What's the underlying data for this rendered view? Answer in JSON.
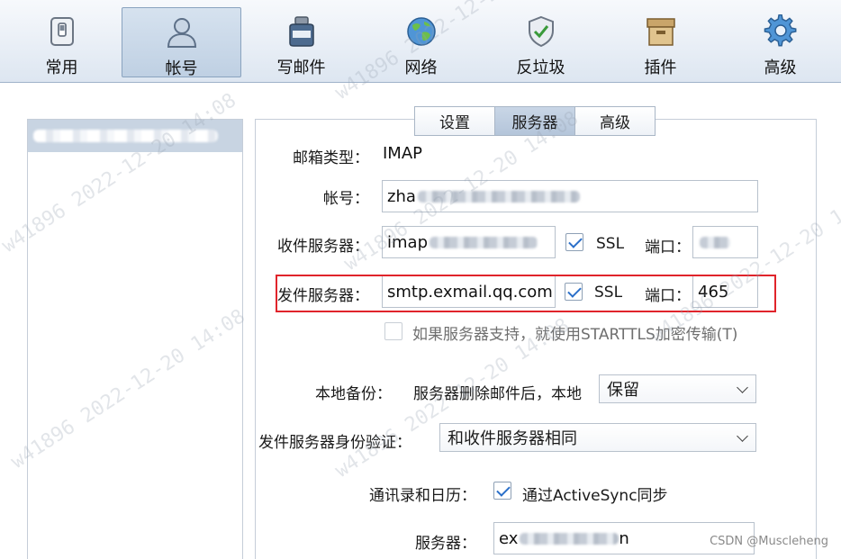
{
  "toolbar": {
    "items": [
      {
        "label": "常用",
        "icon": "general-switch-icon"
      },
      {
        "label": "帐号",
        "icon": "person-icon"
      },
      {
        "label": "写邮件",
        "icon": "compose-inkwell-icon"
      },
      {
        "label": "网络",
        "icon": "globe-icon"
      },
      {
        "label": "反垃圾",
        "icon": "shield-check-icon"
      },
      {
        "label": "插件",
        "icon": "box-icon"
      },
      {
        "label": "高级",
        "icon": "gear-icon"
      }
    ],
    "active_index": 1
  },
  "tabs": [
    {
      "label": "设置"
    },
    {
      "label": "服务器"
    },
    {
      "label": "高级"
    }
  ],
  "form": {
    "mailbox_type_label": "邮箱类型：",
    "mailbox_type_value": "IMAP",
    "account_label": "帐号：",
    "account_value": "zha",
    "incoming_label": "收件服务器：",
    "incoming_value": "imap",
    "ssl_label": "SSL",
    "port_label": "端口：",
    "outgoing_label": "发件服务器：",
    "outgoing_value": "smtp.exmail.qq.com",
    "outgoing_ssl_label": "SSL",
    "outgoing_port_label": "端口：",
    "outgoing_port_value": "465",
    "starttls_label": "如果服务器支持，就使用STARTTLS加密传输(T)",
    "backup_label": "本地备份：",
    "backup_desc": "服务器删除邮件后，本地",
    "backup_select": "保留",
    "auth_label": "发件服务器身份验证：",
    "auth_select": "和收件服务器相同",
    "contacts_label": "通讯录和日历：",
    "activesync_label": "通过ActiveSync同步",
    "server_label": "服务器：",
    "server_value_start": "ex",
    "server_value_end": "n"
  },
  "watermark": {
    "texts": [
      "w41896 2022-12-20 14:08",
      "w41896 2022-12-20 14:08",
      "w41896 2022-12-20 14:08",
      "w41896 2022-12-20 14:08",
      "w41896 2022-12-20 14:08",
      "w41896 2022-12-20 14:08"
    ]
  },
  "credit": "CSDN @Muscleheng"
}
